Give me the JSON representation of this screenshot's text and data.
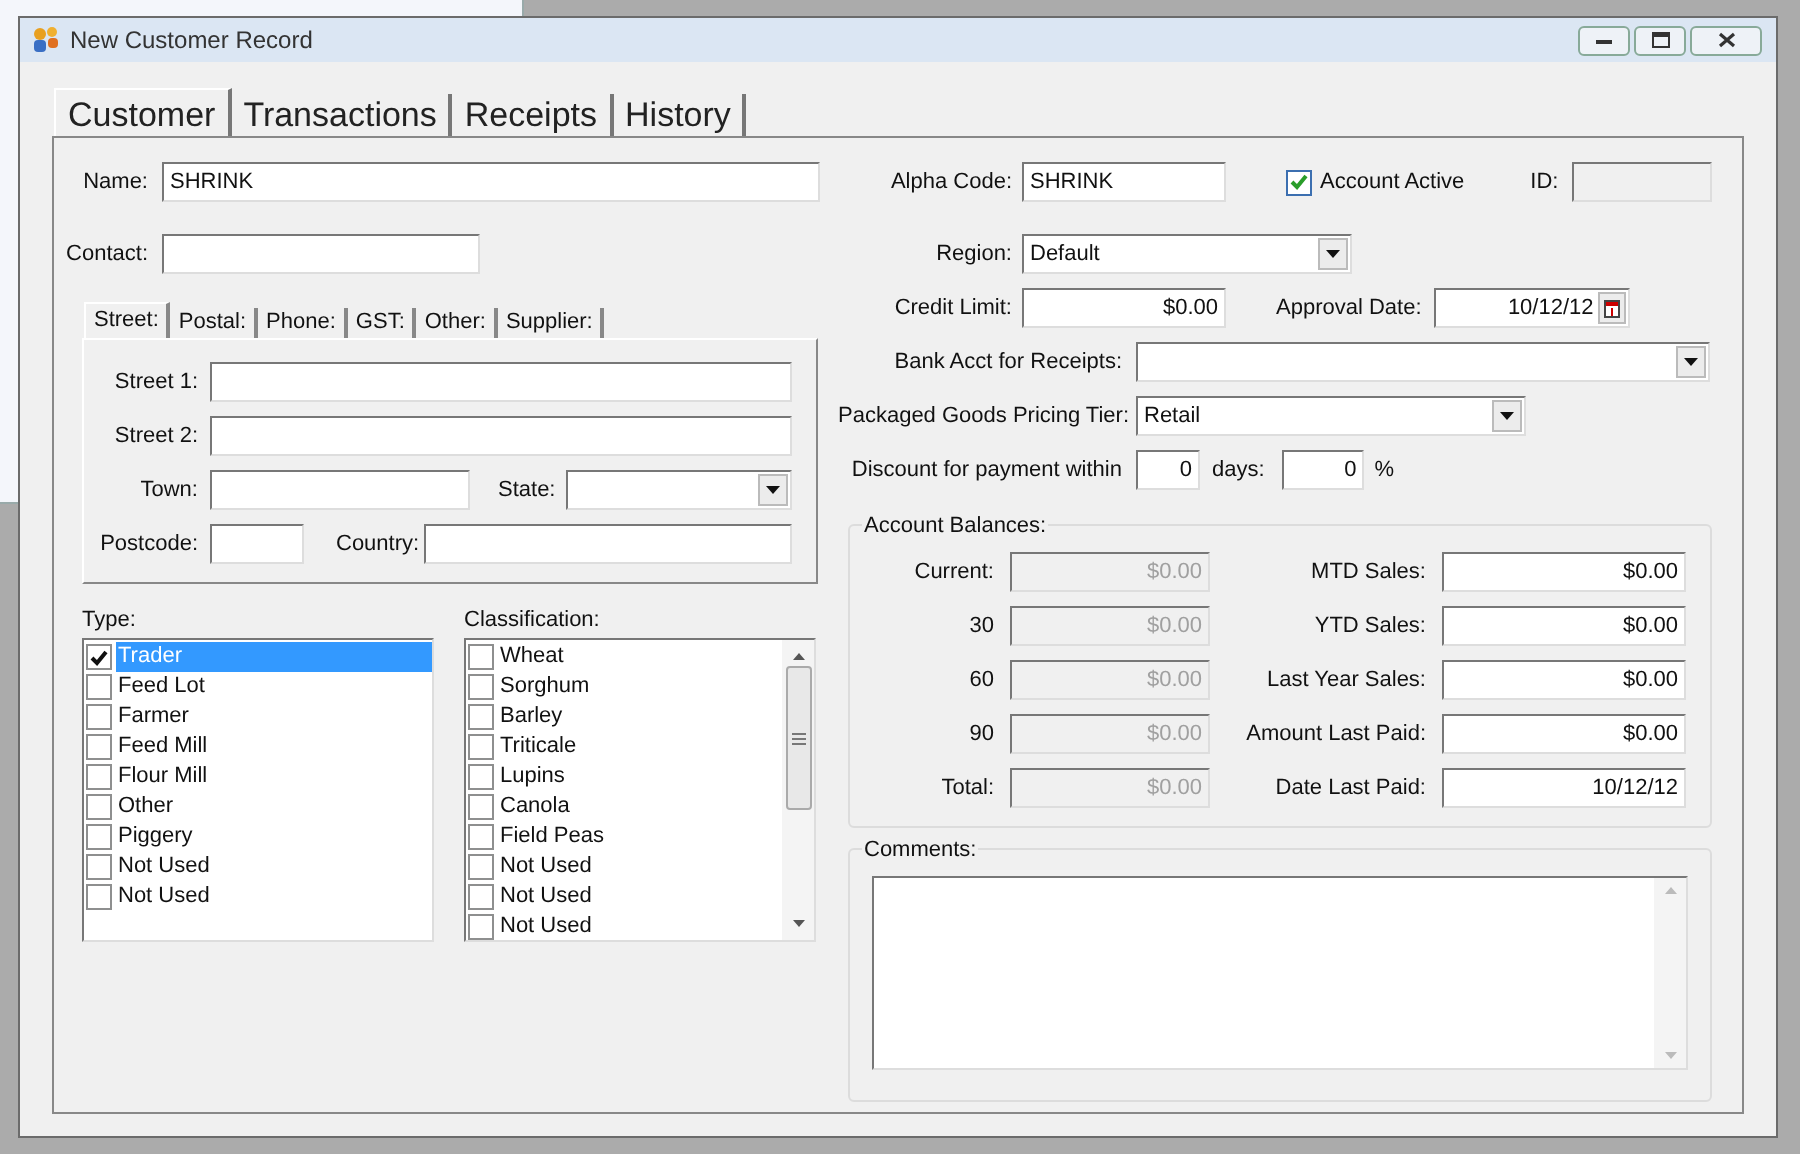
{
  "window": {
    "title": "New Customer Record"
  },
  "tabs": [
    {
      "label": "Customer",
      "selected": true
    },
    {
      "label": "Transactions",
      "selected": false
    },
    {
      "label": "Receipts",
      "selected": false
    },
    {
      "label": "History",
      "selected": false
    }
  ],
  "name": {
    "label": "Name:",
    "value": "SHRINK"
  },
  "contact": {
    "label": "Contact:"
  },
  "address_tabs": [
    {
      "label": "Street:",
      "selected": true
    },
    {
      "label": "Postal:",
      "selected": false
    },
    {
      "label": "Phone:",
      "selected": false
    },
    {
      "label": "GST:",
      "selected": false
    },
    {
      "label": "Other:",
      "selected": false
    },
    {
      "label": "Supplier:",
      "selected": false
    }
  ],
  "address": {
    "street_1": "Street 1:",
    "street_2": "Street 2:",
    "town": "Town:",
    "state": "State:",
    "postcode": "Postcode:",
    "country": "Country:"
  },
  "type_list": {
    "label": "Type:",
    "items": [
      {
        "label": "Trader",
        "checked": true,
        "selected": true
      },
      {
        "label": "Feed Lot",
        "checked": false,
        "selected": false
      },
      {
        "label": "Farmer",
        "checked": false,
        "selected": false
      },
      {
        "label": "Feed Mill",
        "checked": false,
        "selected": false
      },
      {
        "label": "Flour Mill",
        "checked": false,
        "selected": false
      },
      {
        "label": "Other",
        "checked": false,
        "selected": false
      },
      {
        "label": "Piggery",
        "checked": false,
        "selected": false
      },
      {
        "label": "Not Used",
        "checked": false,
        "selected": false
      },
      {
        "label": "Not Used",
        "checked": false,
        "selected": false
      }
    ]
  },
  "classification_list": {
    "label": "Classification:",
    "items": [
      {
        "label": "Wheat",
        "checked": false,
        "selected": false
      },
      {
        "label": "Sorghum",
        "checked": false,
        "selected": false
      },
      {
        "label": "Barley",
        "checked": false,
        "selected": false
      },
      {
        "label": "Triticale",
        "checked": false,
        "selected": false
      },
      {
        "label": "Lupins",
        "checked": false,
        "selected": false
      },
      {
        "label": "Canola",
        "checked": false,
        "selected": false
      },
      {
        "label": "Field Peas",
        "checked": false,
        "selected": false
      },
      {
        "label": "Not Used",
        "checked": false,
        "selected": false
      },
      {
        "label": "Not Used",
        "checked": false,
        "selected": false
      },
      {
        "label": "Not Used",
        "checked": false,
        "selected": false
      }
    ]
  },
  "alpha_code": {
    "label": "Alpha Code:",
    "value": "SHRINK"
  },
  "account_active": {
    "label": "Account Active",
    "checked": true
  },
  "id": {
    "label": "ID:",
    "disabled": true
  },
  "region": {
    "label": "Region:",
    "value": "Default"
  },
  "credit_limit": {
    "label": "Credit Limit:",
    "value": "$0.00"
  },
  "approval_date": {
    "label": "Approval Date:",
    "value": "10/12/12"
  },
  "bank_acct": {
    "label": "Bank Acct for Receipts:"
  },
  "pricing_tier": {
    "label": "Packaged Goods Pricing Tier:",
    "value": "Retail"
  },
  "discount": {
    "label": "Discount for payment within",
    "days_value": "0",
    "days_label": "days:",
    "percent_value": "0",
    "percent_label": "%"
  },
  "account_balances": {
    "title": "Account Balances:",
    "aged": [
      {
        "label": "Current:",
        "value": "$0.00",
        "disabled": true
      },
      {
        "label": "30",
        "value": "$0.00",
        "disabled": true
      },
      {
        "label": "60",
        "value": "$0.00",
        "disabled": true
      },
      {
        "label": "90",
        "value": "$0.00",
        "disabled": true
      },
      {
        "label": "Total:",
        "value": "$0.00",
        "disabled": true
      }
    ],
    "sales": [
      {
        "label": "MTD Sales:",
        "value": "$0.00",
        "disabled": false
      },
      {
        "label": "YTD Sales:",
        "value": "$0.00",
        "disabled": false
      },
      {
        "label": "Last Year Sales:",
        "value": "$0.00",
        "disabled": false
      },
      {
        "label": "Amount Last Paid:",
        "value": "$0.00",
        "disabled": false
      },
      {
        "label": "Date Last Paid:",
        "value": "10/12/12",
        "disabled": false
      }
    ]
  },
  "comments": {
    "label": "Comments:"
  }
}
